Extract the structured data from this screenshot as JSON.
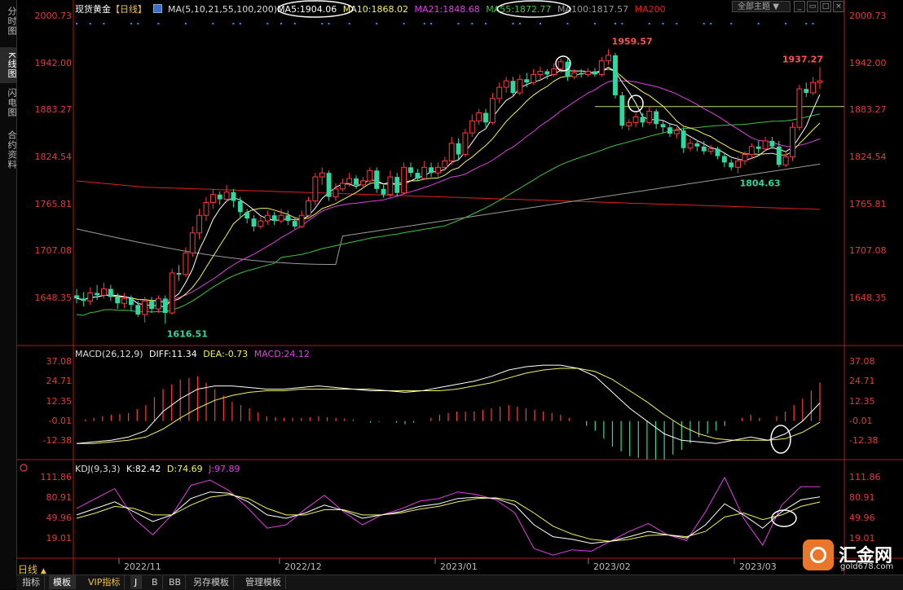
{
  "sidebar": {
    "tabs": [
      {
        "label": "分时图",
        "active": false
      },
      {
        "label": "K线图",
        "active": true
      },
      {
        "label": "闪电图",
        "active": false
      },
      {
        "label": "合约资料",
        "active": false
      }
    ]
  },
  "header": {
    "symbol": "现货黄金",
    "period_tag": "【日线】",
    "ma_group": "MA(5,10,21,55,100,200)",
    "ma5": "MA5:1904.06",
    "ma10": "MA10:1868.02",
    "ma21": "MA21:1848.68",
    "ma55": "MA55:1872.77",
    "ma100": "MA100:1817.57",
    "ma200": "MA200",
    "theme_label": "全部主题"
  },
  "macd_legend": {
    "name": "MACD(26,12,9)",
    "diff": "DIFF:11.34",
    "dea": "DEA:-0.73",
    "macd": "MACD:24.12"
  },
  "kdj_legend": {
    "name": "KDJ(9,3,3)",
    "k": "K:82.42",
    "d": "D:74.69",
    "j": "J:97.89"
  },
  "bottom": {
    "period": "日线",
    "tabs": [
      "指标",
      "模板",
      "VIP指标",
      "J",
      "B",
      "BB",
      "另存模板",
      "管理模板"
    ]
  },
  "logo": {
    "name": "汇金网",
    "url": "gold678.com"
  },
  "colors": {
    "up": "#ff3b3b",
    "down": "#2ed8a0",
    "ma5": "#ffffff",
    "ma10": "#f2f25a",
    "ma21": "#e040e0",
    "ma55": "#3ec43e",
    "ma100": "#9a9a9a",
    "ma200": "#e02020",
    "axis": "#e03c3c",
    "diff": "#ffffff",
    "dea": "#f2f25a",
    "kdj_j": "#e040e0"
  },
  "chart_data": [
    {
      "type": "candlestick",
      "title": "现货黄金 日线",
      "x": [
        "2022/11",
        "2022/12",
        "2023/01",
        "2023/02",
        "2023/03"
      ],
      "y_ticks": [
        2000.73,
        1942.0,
        1883.27,
        1824.54,
        1765.81,
        1707.08,
        1648.35
      ],
      "ylim": [
        1600,
        2000.73
      ],
      "annotations": [
        {
          "label": "1959.57",
          "value": 1959.57
        },
        {
          "label": "1937.27",
          "value": 1937.27
        },
        {
          "label": "1804.63",
          "value": 1804.63
        },
        {
          "label": "1616.51",
          "value": 1616.51
        }
      ],
      "horizontal_line": 1888,
      "candles": [
        [
          1652,
          1648,
          1660,
          1642
        ],
        [
          1648,
          1645,
          1656,
          1638
        ],
        [
          1645,
          1655,
          1662,
          1640
        ],
        [
          1655,
          1652,
          1665,
          1646
        ],
        [
          1652,
          1660,
          1668,
          1648
        ],
        [
          1660,
          1650,
          1665,
          1645
        ],
        [
          1650,
          1642,
          1655,
          1635
        ],
        [
          1642,
          1648,
          1655,
          1636
        ],
        [
          1648,
          1640,
          1652,
          1632
        ],
        [
          1640,
          1628,
          1645,
          1625
        ],
        [
          1628,
          1645,
          1650,
          1618
        ],
        [
          1645,
          1635,
          1650,
          1630
        ],
        [
          1635,
          1648,
          1652,
          1630
        ],
        [
          1648,
          1630,
          1652,
          1616.51
        ],
        [
          1630,
          1680,
          1685,
          1628
        ],
        [
          1680,
          1678,
          1690,
          1670
        ],
        [
          1678,
          1705,
          1712,
          1675
        ],
        [
          1705,
          1730,
          1738,
          1700
        ],
        [
          1730,
          1752,
          1760,
          1722
        ],
        [
          1752,
          1768,
          1775,
          1745
        ],
        [
          1768,
          1778,
          1785,
          1760
        ],
        [
          1778,
          1772,
          1782,
          1765
        ],
        [
          1772,
          1781,
          1790,
          1768
        ],
        [
          1781,
          1770,
          1785,
          1762
        ],
        [
          1770,
          1756,
          1775,
          1750
        ],
        [
          1756,
          1748,
          1760,
          1742
        ],
        [
          1748,
          1738,
          1752,
          1732
        ],
        [
          1738,
          1745,
          1750,
          1735
        ],
        [
          1745,
          1752,
          1758,
          1740
        ],
        [
          1752,
          1745,
          1756,
          1740
        ],
        [
          1745,
          1752,
          1760,
          1742
        ],
        [
          1752,
          1745,
          1758,
          1740
        ],
        [
          1745,
          1738,
          1750,
          1735
        ],
        [
          1738,
          1752,
          1758,
          1736
        ],
        [
          1752,
          1770,
          1775,
          1750
        ],
        [
          1770,
          1800,
          1805,
          1765
        ],
        [
          1800,
          1805,
          1812,
          1790
        ],
        [
          1805,
          1775,
          1808,
          1770
        ],
        [
          1775,
          1785,
          1792,
          1770
        ],
        [
          1785,
          1792,
          1798,
          1782
        ],
        [
          1792,
          1798,
          1805,
          1788
        ],
        [
          1798,
          1790,
          1802,
          1785
        ],
        [
          1790,
          1795,
          1800,
          1786
        ],
        [
          1795,
          1808,
          1812,
          1790
        ],
        [
          1808,
          1785,
          1812,
          1780
        ],
        [
          1785,
          1778,
          1790,
          1774
        ],
        [
          1778,
          1800,
          1808,
          1775
        ],
        [
          1800,
          1780,
          1805,
          1776
        ],
        [
          1780,
          1812,
          1818,
          1778
        ],
        [
          1812,
          1805,
          1818,
          1800
        ],
        [
          1805,
          1798,
          1810,
          1795
        ],
        [
          1798,
          1812,
          1820,
          1796
        ],
        [
          1812,
          1805,
          1818,
          1800
        ],
        [
          1805,
          1812,
          1818,
          1800
        ],
        [
          1812,
          1820,
          1825,
          1808
        ],
        [
          1820,
          1842,
          1850,
          1815
        ],
        [
          1842,
          1828,
          1848,
          1822
        ],
        [
          1828,
          1855,
          1860,
          1825
        ],
        [
          1855,
          1870,
          1878,
          1850
        ],
        [
          1870,
          1880,
          1885,
          1865
        ],
        [
          1880,
          1868,
          1885,
          1862
        ],
        [
          1868,
          1898,
          1905,
          1865
        ],
        [
          1898,
          1912,
          1918,
          1892
        ],
        [
          1912,
          1920,
          1925,
          1905
        ],
        [
          1920,
          1905,
          1925,
          1900
        ],
        [
          1905,
          1922,
          1928,
          1902
        ],
        [
          1922,
          1918,
          1930,
          1912
        ],
        [
          1918,
          1928,
          1935,
          1915
        ],
        [
          1928,
          1932,
          1938,
          1922
        ],
        [
          1932,
          1928,
          1935,
          1922
        ],
        [
          1928,
          1935,
          1942,
          1925
        ],
        [
          1935,
          1944,
          1948,
          1930
        ],
        [
          1944,
          1925,
          1948,
          1920
        ],
        [
          1925,
          1930,
          1935,
          1922
        ],
        [
          1930,
          1928,
          1935,
          1924
        ],
        [
          1928,
          1932,
          1936,
          1925
        ],
        [
          1932,
          1928,
          1936,
          1925
        ],
        [
          1928,
          1945,
          1950,
          1925
        ],
        [
          1945,
          1952,
          1959.57,
          1940
        ],
        [
          1952,
          1902,
          1955,
          1898
        ],
        [
          1902,
          1864,
          1906,
          1860
        ],
        [
          1864,
          1868,
          1872,
          1858
        ],
        [
          1868,
          1875,
          1880,
          1862
        ],
        [
          1875,
          1868,
          1880,
          1862
        ],
        [
          1868,
          1882,
          1888,
          1865
        ],
        [
          1882,
          1866,
          1885,
          1860
        ],
        [
          1866,
          1862,
          1870,
          1855
        ],
        [
          1862,
          1854,
          1866,
          1850
        ],
        [
          1854,
          1858,
          1862,
          1848
        ],
        [
          1858,
          1836,
          1862,
          1830
        ],
        [
          1836,
          1842,
          1848,
          1832
        ],
        [
          1842,
          1838,
          1846,
          1832
        ],
        [
          1838,
          1832,
          1845,
          1828
        ],
        [
          1832,
          1835,
          1840,
          1828
        ],
        [
          1835,
          1826,
          1838,
          1822
        ],
        [
          1826,
          1818,
          1830,
          1812
        ],
        [
          1818,
          1812,
          1822,
          1808
        ],
        [
          1812,
          1820,
          1825,
          1804.63
        ],
        [
          1820,
          1828,
          1832,
          1815
        ],
        [
          1828,
          1838,
          1842,
          1822
        ],
        [
          1838,
          1835,
          1845,
          1830
        ],
        [
          1835,
          1845,
          1850,
          1832
        ],
        [
          1845,
          1838,
          1850,
          1835
        ],
        [
          1838,
          1815,
          1845,
          1812
        ],
        [
          1815,
          1825,
          1832,
          1812
        ],
        [
          1825,
          1862,
          1868,
          1820
        ],
        [
          1862,
          1910,
          1915,
          1858
        ],
        [
          1910,
          1905,
          1918,
          1900
        ],
        [
          1905,
          1918,
          1925,
          1902
        ],
        [
          1918,
          1920,
          1937.27,
          1910
        ]
      ]
    },
    {
      "type": "macd",
      "title": "MACD(26,12,9)",
      "y_ticks": [
        37.08,
        24.71,
        12.35,
        -0.01,
        -12.38
      ],
      "ylim": [
        -24,
        40
      ],
      "series": [
        {
          "name": "DIFF",
          "values": [
            -14,
            -13,
            -12,
            -10,
            -6,
            6,
            14,
            20,
            22,
            22,
            21,
            20,
            20,
            21,
            22,
            21,
            20,
            19,
            19,
            18,
            19,
            21,
            23,
            25,
            28,
            32,
            34,
            35,
            35,
            33,
            28,
            18,
            8,
            0,
            -8,
            -12,
            -13,
            -14,
            -12,
            -10,
            -12,
            -8,
            0,
            11.34
          ]
        },
        {
          "name": "DEA",
          "values": [
            -14,
            -14,
            -13,
            -12,
            -10,
            -5,
            2,
            8,
            13,
            16,
            18,
            19,
            19,
            20,
            20,
            20,
            20,
            20,
            19,
            19,
            19,
            19,
            20,
            22,
            24,
            27,
            30,
            32,
            33,
            33,
            31,
            26,
            19,
            12,
            4,
            -3,
            -8,
            -11,
            -12,
            -12,
            -12,
            -11,
            -7,
            -0.73
          ]
        },
        {
          "name": "MACD",
          "values": [
            0,
            2,
            4,
            5,
            10,
            20,
            26,
            28,
            20,
            12,
            8,
            3,
            2,
            2,
            3,
            2,
            1,
            -1,
            0,
            -2,
            0,
            4,
            6,
            6,
            8,
            10,
            8,
            6,
            4,
            0,
            -6,
            -16,
            -22,
            -24,
            -24,
            -18,
            -10,
            -6,
            0,
            4,
            0,
            6,
            14,
            24.12
          ]
        }
      ]
    },
    {
      "type": "kdj",
      "title": "KDJ(9,3,3)",
      "y_ticks": [
        111.86,
        80.91,
        49.96,
        19.01
      ],
      "ylim": [
        0,
        120
      ],
      "series": [
        {
          "name": "K",
          "values": [
            55,
            65,
            75,
            60,
            45,
            55,
            80,
            90,
            88,
            75,
            55,
            50,
            58,
            70,
            62,
            50,
            55,
            60,
            68,
            72,
            80,
            82,
            80,
            70,
            40,
            22,
            18,
            12,
            15,
            22,
            30,
            25,
            20,
            40,
            72,
            55,
            35,
            60,
            78,
            82.42
          ]
        },
        {
          "name": "D",
          "values": [
            50,
            58,
            68,
            65,
            55,
            55,
            70,
            82,
            86,
            80,
            65,
            55,
            55,
            63,
            63,
            55,
            55,
            58,
            64,
            68,
            75,
            80,
            81,
            76,
            58,
            38,
            26,
            18,
            15,
            18,
            24,
            25,
            22,
            30,
            52,
            58,
            48,
            55,
            68,
            74.69
          ]
        },
        {
          "name": "J",
          "values": [
            65,
            80,
            95,
            50,
            25,
            55,
            100,
            108,
            92,
            65,
            35,
            40,
            64,
            85,
            60,
            40,
            55,
            64,
            76,
            80,
            90,
            86,
            78,
            58,
            4,
            -6,
            2,
            0,
            15,
            30,
            42,
            25,
            16,
            60,
            112,
            50,
            9,
            70,
            98,
            97.89
          ]
        }
      ]
    }
  ]
}
